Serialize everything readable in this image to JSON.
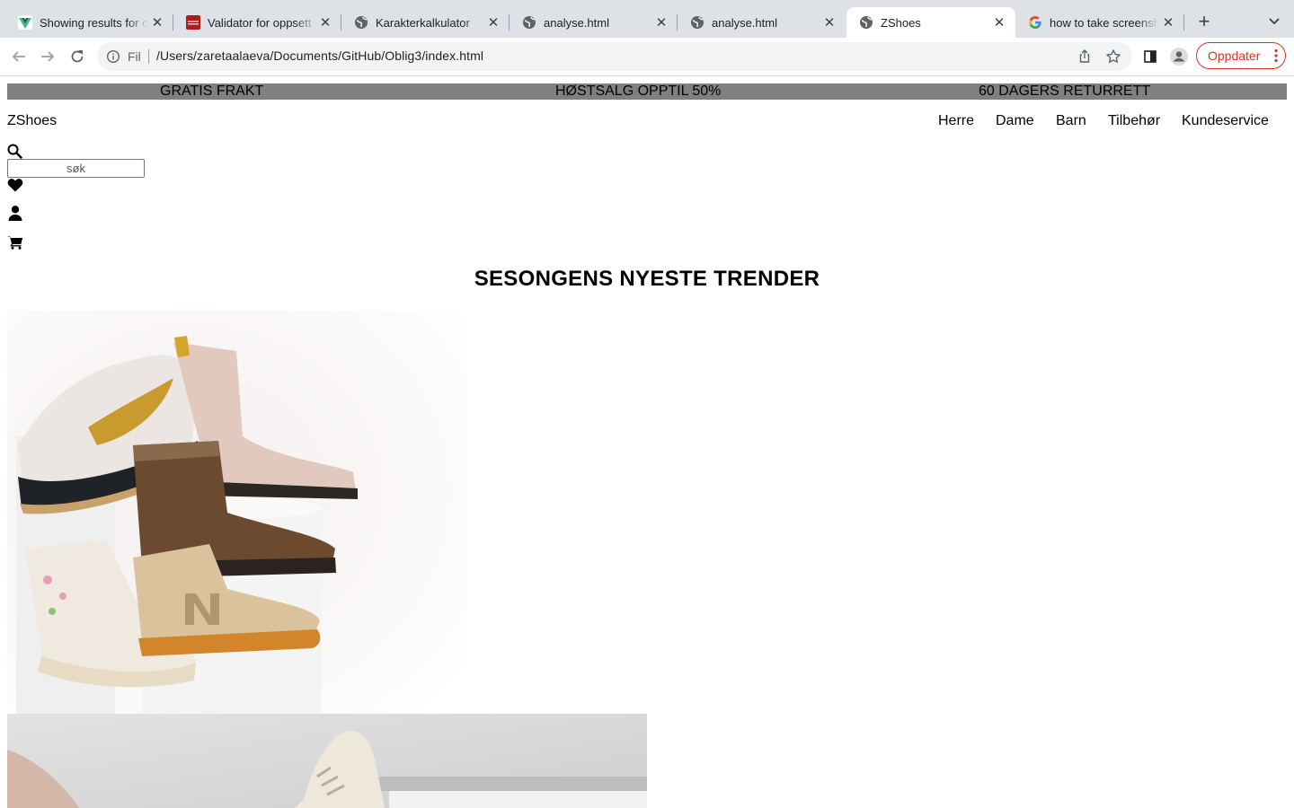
{
  "browser": {
    "tabs": [
      {
        "title": "Showing results for c",
        "favicon": "vue-logo-icon"
      },
      {
        "title": "Validator for oppsett",
        "favicon": "validator-icon"
      },
      {
        "title": "Karakterkalkulator",
        "favicon": "globe-icon"
      },
      {
        "title": "analyse.html",
        "favicon": "globe-icon"
      },
      {
        "title": "analyse.html",
        "favicon": "globe-icon"
      },
      {
        "title": "ZShoes",
        "favicon": "globe-icon",
        "active": true
      },
      {
        "title": "how to take screensh",
        "favicon": "google-icon"
      }
    ],
    "chip_label": "Fil",
    "url": "/Users/zaretaalaeva/Documents/GitHub/Oblig3/index.html",
    "update_label": "Oppdater",
    "accent_color": "#d93025"
  },
  "promo": {
    "items": [
      "GRATIS FRAKT",
      "HØSTSALG OPPTIL 50%",
      "60 DAGERS RETURRETT"
    ],
    "bg_color": "#808080"
  },
  "header": {
    "logo": "ZShoes",
    "nav": [
      "Herre",
      "Dame",
      "Barn",
      "Tilbehør",
      "Kundeservice"
    ],
    "search_placeholder": "søk",
    "icons": [
      "search-icon",
      "heart-icon",
      "user-icon",
      "cart-icon"
    ]
  },
  "main": {
    "title": "SESONGENS NYESTE TRENDER",
    "images": [
      "sneakers-and-boots-collage",
      "beige-sneaker-closeup"
    ]
  }
}
